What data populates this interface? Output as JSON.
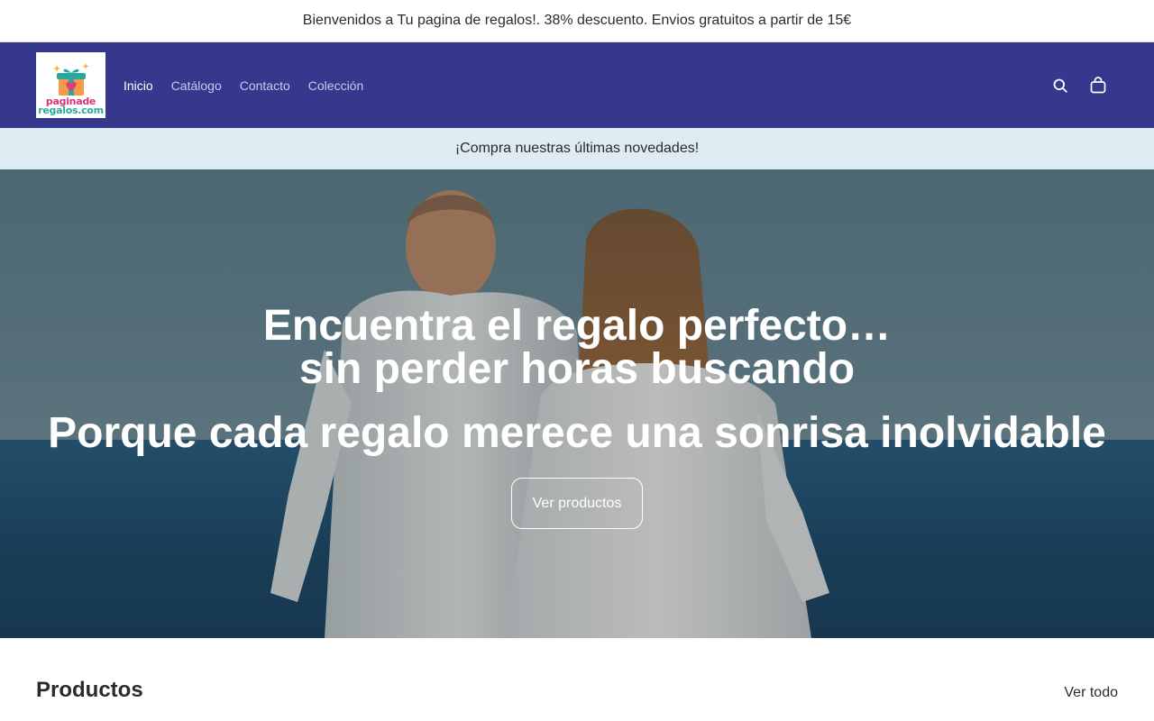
{
  "announcement": "Bienvenidos a Tu pagina de regalos!. 38% descuento. Envios gratuitos a partir de 15€",
  "header": {
    "logo_lines": [
      "paginade",
      "regalos.com"
    ],
    "nav": [
      "Inicio",
      "Catálogo",
      "Contacto",
      "Colección"
    ],
    "icons": [
      "search-icon",
      "cart-icon"
    ]
  },
  "promo_bar": "¡Compra nuestras últimas novedades!",
  "hero": {
    "title_line1": "Encuentra el regalo perfecto…",
    "title_line2": "sin perder horas buscando",
    "subtitle": "Porque cada regalo merece una sonrisa inolvidable",
    "button": "Ver productos"
  },
  "products": {
    "title": "Productos",
    "view_all": "Ver todo"
  },
  "colors": {
    "header_bg": "#35388c",
    "promo_bg": "#deebf3"
  }
}
